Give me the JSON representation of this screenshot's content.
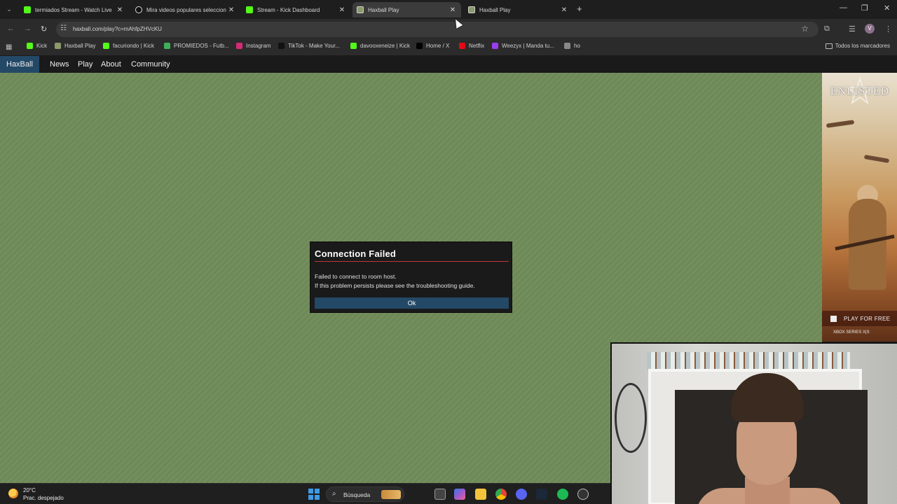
{
  "tabs": [
    {
      "title": "termiados Stream - Watch Live",
      "favicon": "kick-icon",
      "active": false
    },
    {
      "title": "Mira videos populares seleccion",
      "favicon": "tiktok-icon",
      "active": false
    },
    {
      "title": "Stream - Kick Dashboard",
      "favicon": "kick-icon",
      "active": false
    },
    {
      "title": "Haxball Play",
      "favicon": "haxball-icon",
      "active": true
    },
    {
      "title": "Haxball Play",
      "favicon": "haxball-icon",
      "active": false
    }
  ],
  "address_bar": {
    "url": "haxball.com/play?c=mAhfpZHVcKU"
  },
  "bookmarks": [
    {
      "label": "Kick",
      "color": "#53fc18"
    },
    {
      "label": "Haxball Play",
      "color": "#8a9a6a"
    },
    {
      "label": "facuriondo | Kick",
      "color": "#53fc18"
    },
    {
      "label": "PROMIEDOS - Futb...",
      "color": "#3fae5a"
    },
    {
      "label": "Instagram",
      "color": "#d6297a"
    },
    {
      "label": "TikTok - Make Your...",
      "color": "#111111"
    },
    {
      "label": "davooxeneize | Kick",
      "color": "#53fc18"
    },
    {
      "label": "Home / X",
      "color": "#000000"
    },
    {
      "label": "Netflix",
      "color": "#e50914"
    },
    {
      "label": "Weezyx | Manda tu...",
      "color": "#9b3cf0"
    },
    {
      "label": "ho",
      "color": "#888888"
    }
  ],
  "bookmarks_all": "Todos los marcadores",
  "site_nav": {
    "brand": "HaxBall",
    "items": [
      "News",
      "Play",
      "About",
      "Community"
    ]
  },
  "dialog": {
    "title": "Connection Failed",
    "line1": "Failed to connect to room host.",
    "line2": "If this problem persists please see the troubleshooting guide.",
    "ok_label": "Ok"
  },
  "ad": {
    "logo": "ENLISTED",
    "cta": "PLAY FOR FREE",
    "platforms": "XBOX SERIES X|S"
  },
  "taskbar": {
    "temperature": "20°C",
    "weather": "Prac. despejado",
    "search_placeholder": "Búsqueda"
  },
  "colors": {
    "field": "#718c5a",
    "brand_blue": "#244967",
    "dialog_rule": "#c13535"
  }
}
